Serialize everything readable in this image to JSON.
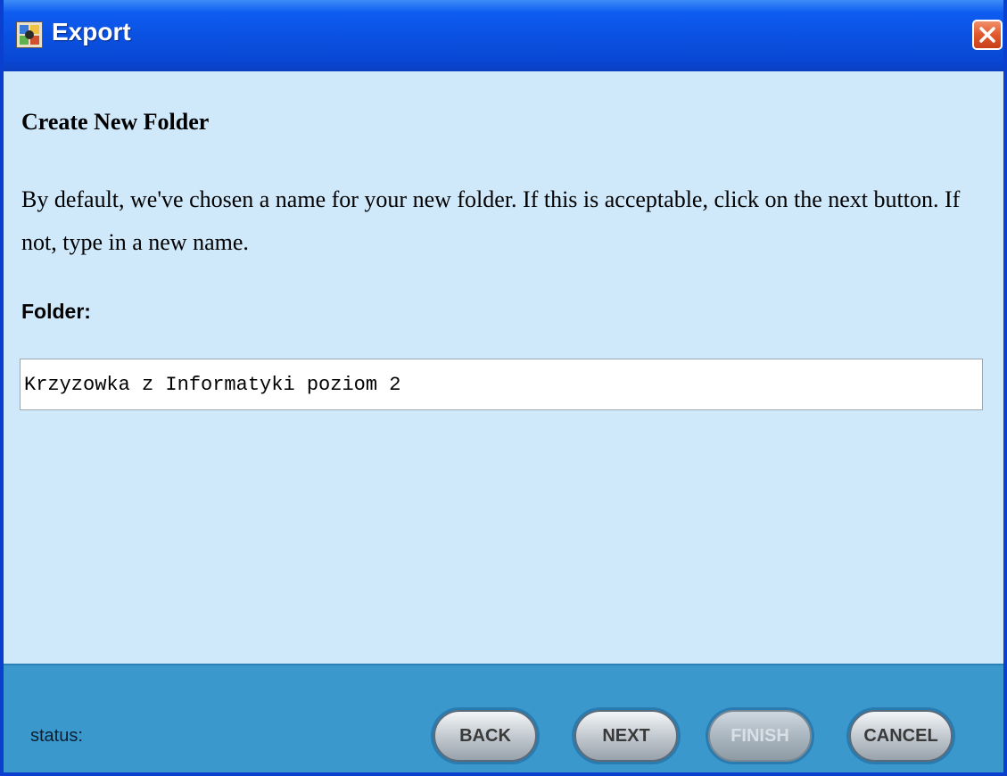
{
  "window": {
    "title": "Export",
    "icon": "app-icon",
    "close_icon": "close-icon"
  },
  "content": {
    "heading": "Create New Folder",
    "description": "By default, we've chosen a name for your new folder.  If this is acceptable, click on the next button.  If not, type in a new name.",
    "folder_label": "Folder:",
    "folder_value": "Krzyzowka z Informatyki poziom 2"
  },
  "footer": {
    "status_label": "status:",
    "buttons": {
      "back": "BACK",
      "next": "NEXT",
      "finish": "FINISH",
      "cancel": "CANCEL"
    }
  },
  "colors": {
    "title_bar": "#0a50e0",
    "content_bg": "#cfe9fb",
    "footer_bg": "#3a98cc",
    "close_button": "#e2582e"
  }
}
